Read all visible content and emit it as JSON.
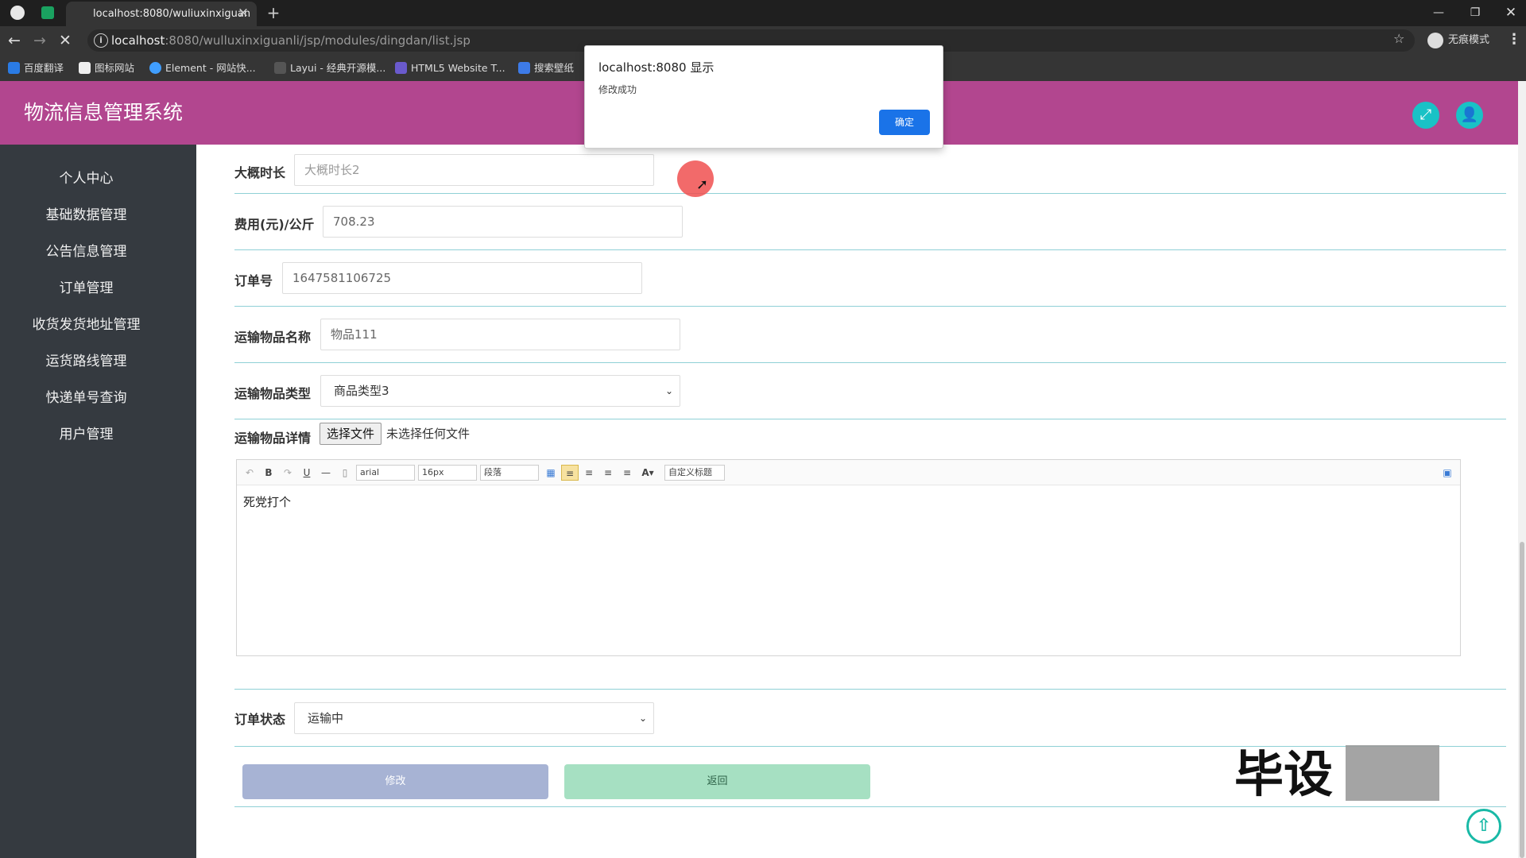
{
  "browser": {
    "tab_title": "localhost:8080/wuliuxinxiguan",
    "url_host": "localhost",
    "url_rest": ":8080/wulluxinxiguanli/jsp/modules/dingdan/list.jsp",
    "profile_label": "无痕模式",
    "bookmarks": [
      "百度翻译",
      "图标网站",
      "Element - 网站快...",
      "Layui - 经典开源模...",
      "HTML5 Website T...",
      "搜索壁纸"
    ]
  },
  "app": {
    "title": "物流信息管理系统",
    "accent_color": "#b2468f",
    "sidebar_color": "#353a40"
  },
  "sidebar": {
    "items": [
      "个人中心",
      "基础数据管理",
      "公告信息管理",
      "订单管理",
      "收货发货地址管理",
      "运货路线管理",
      "快递单号查询",
      "用户管理"
    ]
  },
  "form": {
    "duration": {
      "label": "大概时长",
      "placeholder": "大概时长2"
    },
    "fee": {
      "label": "费用(元)/公斤",
      "value": "708.23"
    },
    "order_no": {
      "label": "订单号",
      "value": "1647581106725"
    },
    "goods_name": {
      "label": "运输物品名称",
      "value": "物品111"
    },
    "goods_type": {
      "label": "运输物品类型",
      "value": "商品类型3"
    },
    "goods_detail": {
      "label": "运输物品详情",
      "file_button": "选择文件",
      "file_status": "未选择任何文件",
      "editor_content": "死党打个",
      "toolbar": {
        "font": "arial",
        "size": "16px",
        "paragraph": "段落",
        "custom_title": "自定义标题"
      }
    },
    "status": {
      "label": "订单状态",
      "value": "运输中"
    },
    "submit_label": "修改",
    "back_label": "返回"
  },
  "dialog": {
    "title": "localhost:8080 显示",
    "message": "修改成功",
    "ok_label": "确定"
  },
  "watermark": "毕设"
}
